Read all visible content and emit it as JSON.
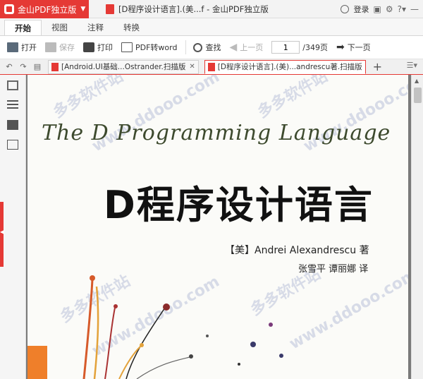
{
  "app": {
    "name": "金山PDF独立版",
    "window_title": "[D程序设计语言].(美...f - 金山PDF独立版",
    "login_label": "登录"
  },
  "menu": {
    "tabs": [
      "开始",
      "视图",
      "注释",
      "转换"
    ]
  },
  "toolbar": {
    "open": "打开",
    "save": "保存",
    "print": "打印",
    "pdf_to_word": "PDF转word",
    "find": "查找",
    "prev_page": "上一页",
    "current_page": "1",
    "total_pages": "/349页",
    "next_page": "下一页"
  },
  "doc_tabs": [
    {
      "label": "[Android.UI基础...Ostrander.扫描版"
    },
    {
      "label": "[D程序设计语言].(美)...andrescu著.扫描版"
    }
  ],
  "document": {
    "title_en": "The D Programming Language",
    "title_cn": "D程序设计语言",
    "author": "【美】Andrei Alexandrescu  著",
    "translators": "张雪平  谭丽娜  译",
    "watermark_cn": "多多软件站",
    "watermark_url": "www.ddooo.com"
  },
  "colors": {
    "accent": "#e53935",
    "title_en": "#3d4a2e"
  }
}
